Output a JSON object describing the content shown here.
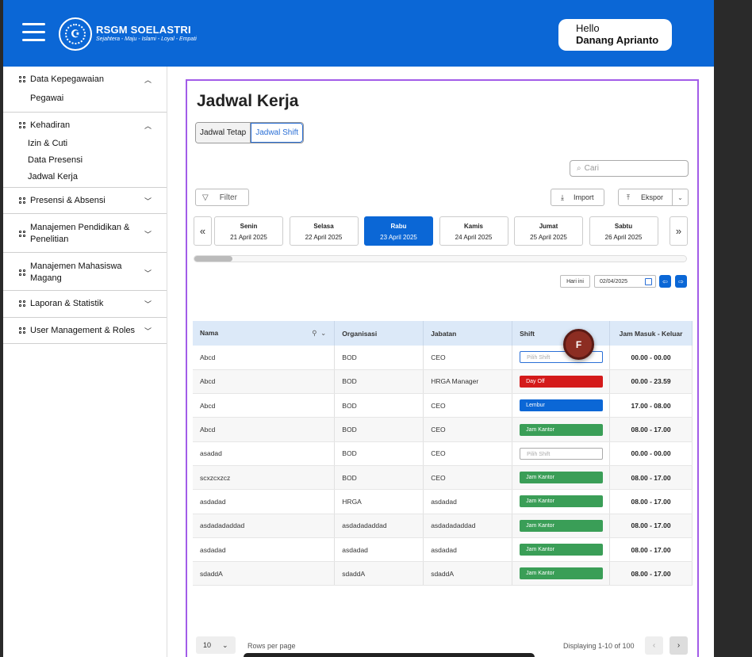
{
  "header": {
    "brand_name": "RSGM SOELASTRI",
    "brand_tagline": "Sejahtera - Maju - Islami - Loyal - Empati",
    "greeting": "Hello",
    "user_name": "Danang Aprianto",
    "accent_color": "#0b67d6"
  },
  "sidebar": {
    "groups": [
      {
        "label": "Data Kepegawaian",
        "chevron": "up",
        "items": [
          "Pegawai"
        ]
      },
      {
        "label": "Kehadiran",
        "chevron": "up",
        "items": [
          "Izin & Cuti",
          "Data Presensi",
          "Jadwal Kerja"
        ]
      },
      {
        "label": "Presensi & Absensi",
        "chevron": "down",
        "items": []
      },
      {
        "label": "Manajemen Pendidikan & Penelitian",
        "chevron": "down",
        "items": []
      },
      {
        "label": "Manajemen Mahasiswa Magang",
        "chevron": "down",
        "items": []
      },
      {
        "label": "Laporan & Statistik",
        "chevron": "down",
        "items": []
      },
      {
        "label": "User Management & Roles",
        "chevron": "down",
        "items": []
      }
    ]
  },
  "main": {
    "title": "Jadwal Kerja",
    "tabs": {
      "tetap": "Jadwal Tetap",
      "shift": "Jadwal Shift",
      "active": "shift"
    },
    "search_placeholder": "Cari",
    "filter_label": "Filter",
    "import_label": "Import",
    "export_label": "Ekspor",
    "days": [
      {
        "name": "Senin",
        "date": "21 April 2025",
        "active": false
      },
      {
        "name": "Selasa",
        "date": "22 April 2025",
        "active": false
      },
      {
        "name": "Rabu",
        "date": "23 April 2025",
        "active": true
      },
      {
        "name": "Kamis",
        "date": "24 April 2025",
        "active": false
      },
      {
        "name": "Jumat",
        "date": "25 April 2025",
        "active": false
      },
      {
        "name": "Sabtu",
        "date": "26 April 2025",
        "active": false
      }
    ],
    "today_label": "Hari ini",
    "date_value": "02/04/2025",
    "table": {
      "headers": [
        "Nama",
        "Organisasi",
        "Jabatan",
        "Shift",
        "Jam Masuk - Keluar"
      ],
      "rows": [
        {
          "nama": "Abcd",
          "org": "BOD",
          "jabatan": "CEO",
          "shift": "Pilih Shift",
          "shift_type": "empty",
          "jam": "00.00 - 00.00"
        },
        {
          "nama": "Abcd",
          "org": "BOD",
          "jabatan": "HRGA Manager",
          "shift": "Day Off",
          "shift_type": "dayoff",
          "jam": "00.00 - 23.59"
        },
        {
          "nama": "Abcd",
          "org": "BOD",
          "jabatan": "CEO",
          "shift": "Lembur",
          "shift_type": "lembur",
          "jam": "17.00 - 08.00"
        },
        {
          "nama": "Abcd",
          "org": "BOD",
          "jabatan": "CEO",
          "shift": "Jam Kantor",
          "shift_type": "kantor",
          "jam": "08.00 - 17.00"
        },
        {
          "nama": "asadad",
          "org": "BOD",
          "jabatan": "CEO",
          "shift": "Pilih Shift",
          "shift_type": "empty",
          "jam": "00.00 - 00.00"
        },
        {
          "nama": "scxzcxzcz",
          "org": "BOD",
          "jabatan": "CEO",
          "shift": "Jam Kantor",
          "shift_type": "kantor",
          "jam": "08.00 - 17.00"
        },
        {
          "nama": "asdadad",
          "org": "HRGA",
          "jabatan": "asdadad",
          "shift": "Jam Kantor",
          "shift_type": "kantor",
          "jam": "08.00 - 17.00"
        },
        {
          "nama": "asdadadaddad",
          "org": "asdadadaddad",
          "jabatan": "asdadadaddad",
          "shift": "Jam Kantor",
          "shift_type": "kantor",
          "jam": "08.00 - 17.00"
        },
        {
          "nama": "asdadad",
          "org": "asdadad",
          "jabatan": "asdadad",
          "shift": "Jam Kantor",
          "shift_type": "kantor",
          "jam": "08.00 - 17.00"
        },
        {
          "nama": "sdaddA",
          "org": "sdaddA",
          "jabatan": "sdaddA",
          "shift": "Jam Kantor",
          "shift_type": "kantor",
          "jam": "08.00 - 17.00"
        }
      ]
    },
    "pagination": {
      "rows_per_page_value": "10",
      "rows_per_page_label": "Rows per page",
      "displaying": "Displaying 1-10 of 100"
    },
    "avatar_letter": "F"
  }
}
